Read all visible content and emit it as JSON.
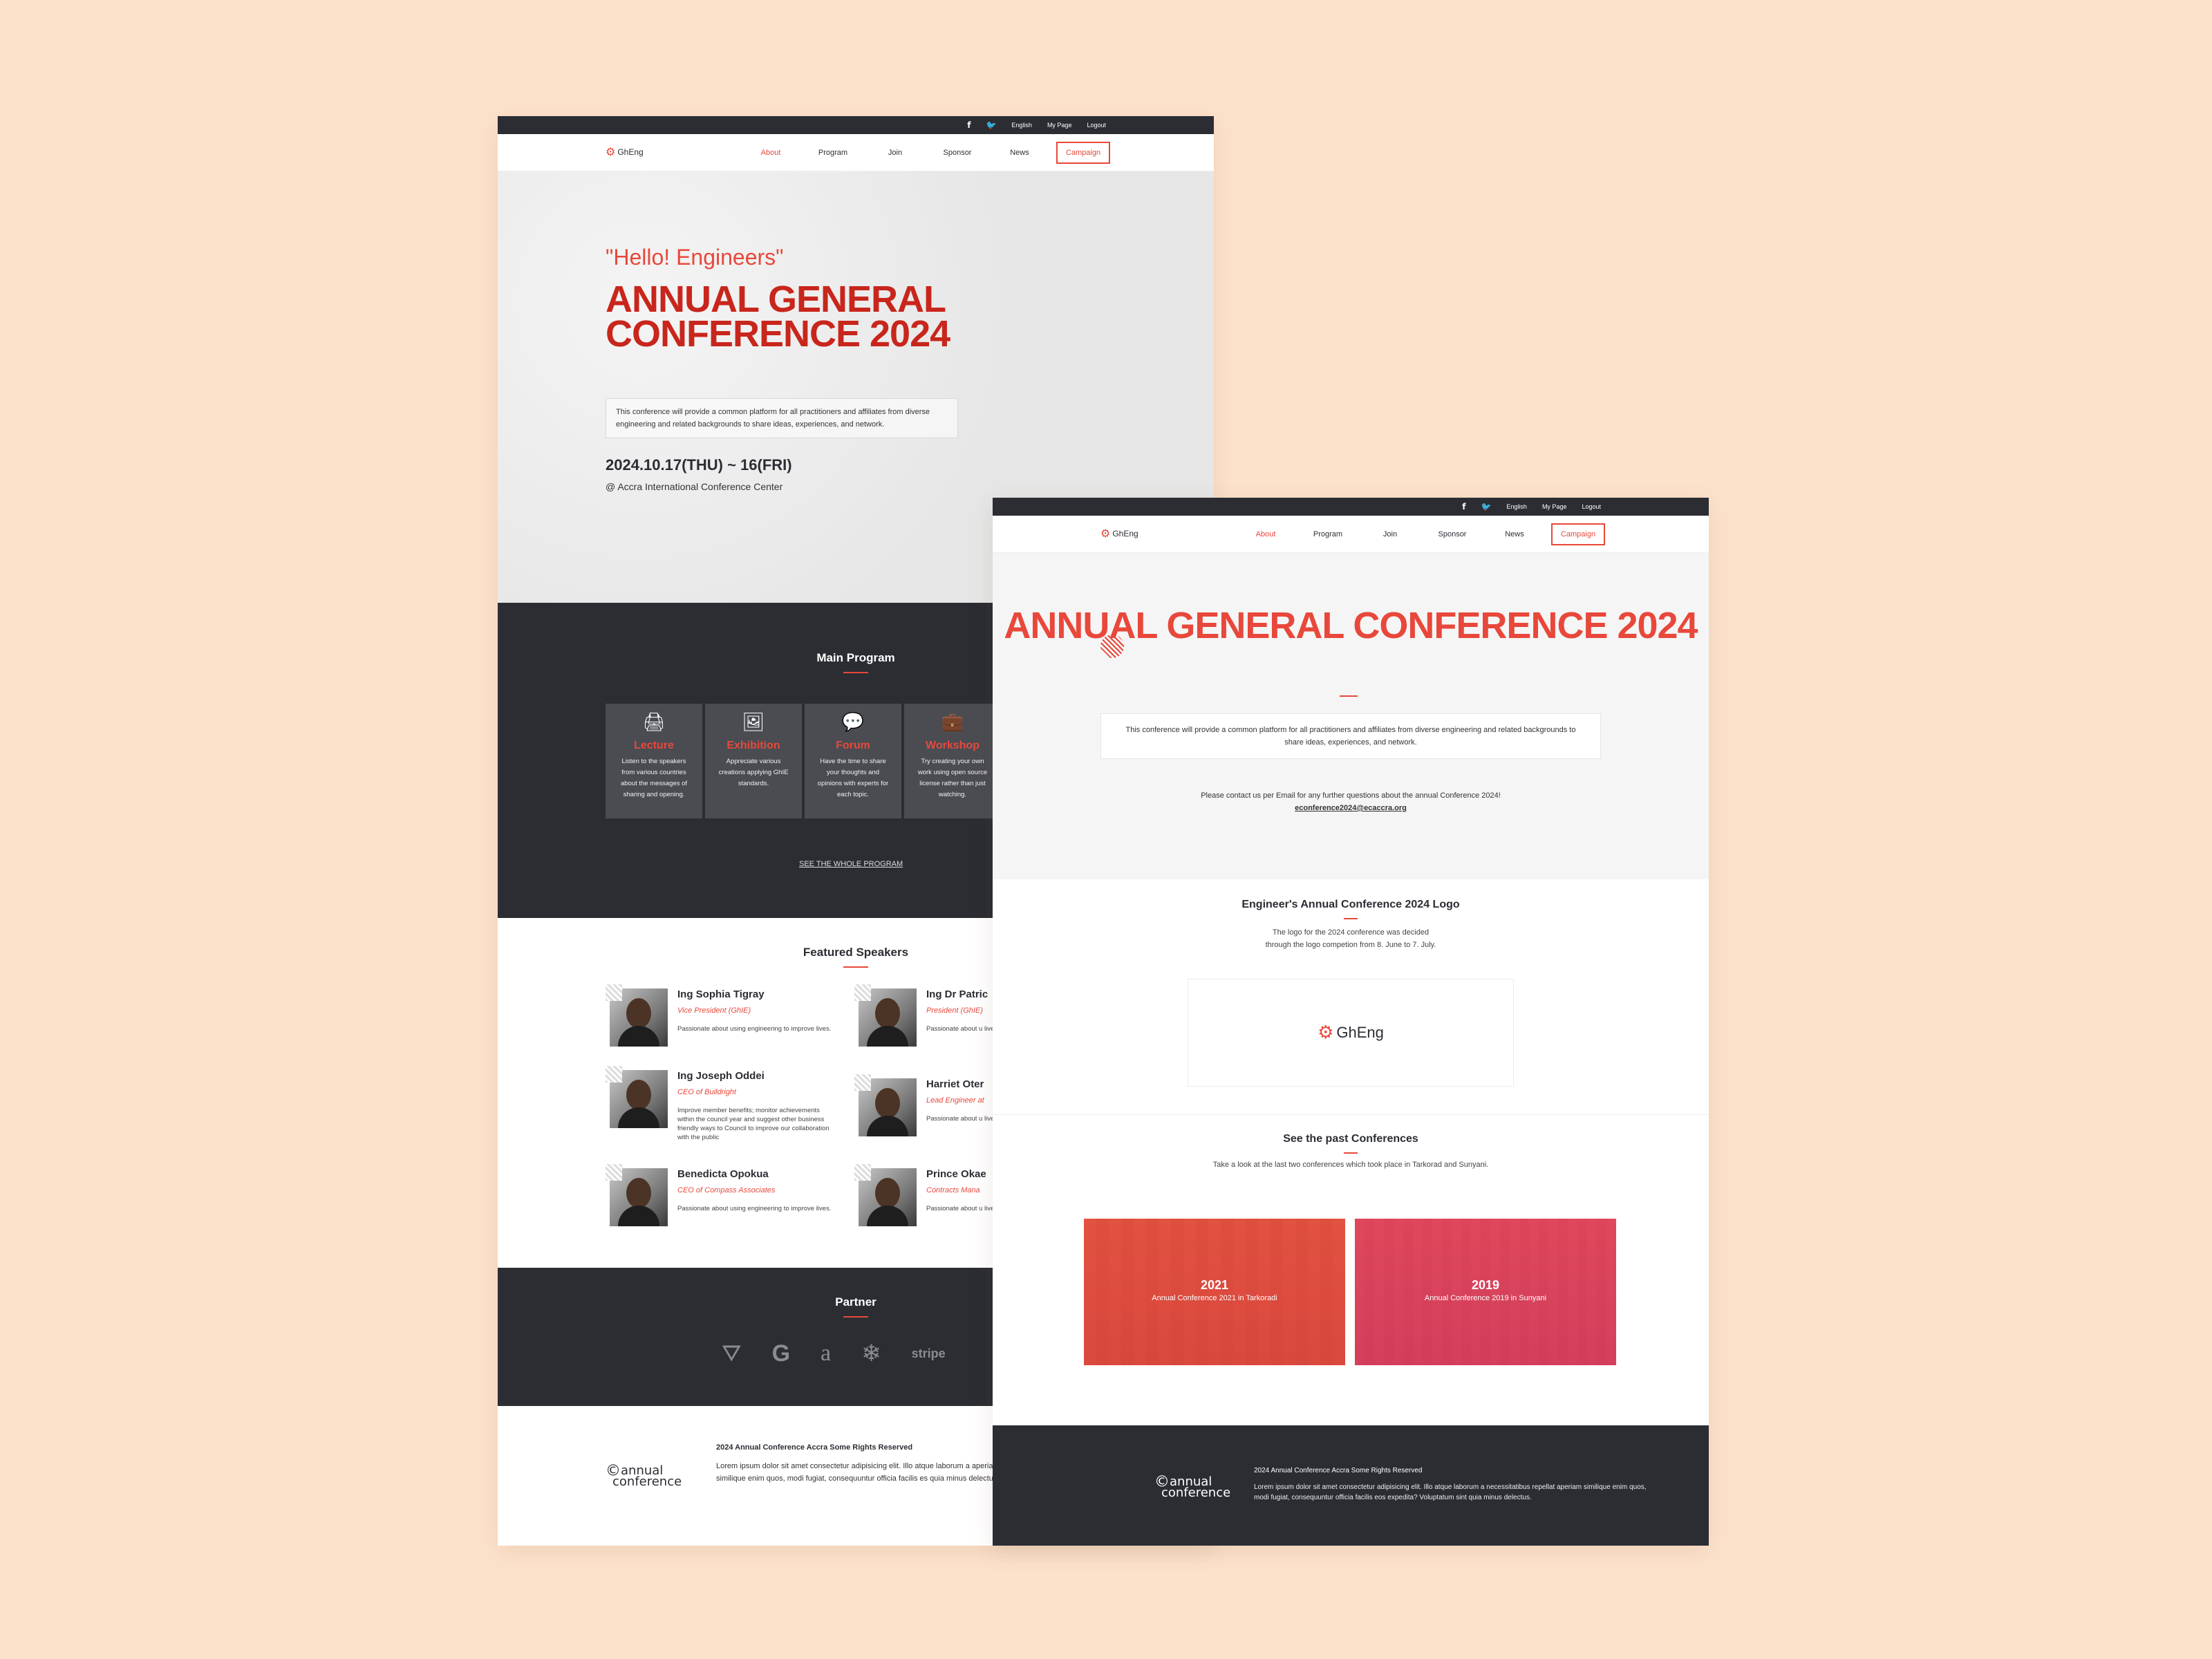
{
  "colors": {
    "background": "#fde2cb",
    "accent": "#e8483b",
    "dark": "#2b2d33"
  },
  "topbar": {
    "facebook": "f",
    "twitter": "🐦",
    "lang": "English",
    "mypage": "My Page",
    "logout": "Logout"
  },
  "nav": {
    "logo": "GhEng",
    "about": "About",
    "program": "Program",
    "join": "Join",
    "sponsor": "Sponsor",
    "news": "News",
    "campaign": "Campaign"
  },
  "pageA": {
    "hero": {
      "hello": "\"Hello! Engineers\"",
      "title": "ANNUAL GENERAL CONFERENCE 2024",
      "desc": "This conference will provide a common platform for all practitioners and affiliates from diverse engineering and related backgrounds to share ideas, experiences, and network.",
      "date": "2024.10.17(THU) ~ 16(FRI)",
      "venue": "@ Accra International Conference Center"
    },
    "program": {
      "title": "Main Program",
      "cards": [
        {
          "icon": "lecture-icon",
          "title": "Lecture",
          "desc": "Listen to the speakers from various countries about the messages of sharing and opening."
        },
        {
          "icon": "exhibition-icon",
          "title": "Exhibition",
          "desc": "Appreciate various creations applying GhIE standards."
        },
        {
          "icon": "forum-icon",
          "title": "Forum",
          "desc": "Have the time to share your thoughts and opinions with experts for each topic."
        },
        {
          "icon": "workshop-icon",
          "title": "Workshop",
          "desc": "Try creating your own work using open source license rather than just watching."
        }
      ],
      "see_all": "SEE THE WHOLE PROGRAM"
    },
    "speakers": {
      "title": "Featured Speakers",
      "list": [
        {
          "name": "Ing Sophia Tigray",
          "role": "Vice President (GhIE)",
          "desc": "Passionate about using engineering to improve lives."
        },
        {
          "name": "Ing Dr Patric",
          "role": "President (GhIE)",
          "desc": "Passionate about u lives."
        },
        {
          "name": "Ing Joseph Oddei",
          "role": "CEO of Buildright",
          "desc": "Improve member benefits; monitor achievements within the council year and suggest other business friendly ways to Council to improve our collaboration with the public"
        },
        {
          "name": "Harriet Oter",
          "role": "Lead Engineer at",
          "desc": "Passionate about u lives."
        },
        {
          "name": "Benedicta Opokua",
          "role": "CEO of Compass Associates",
          "desc": "Passionate about using engineering to improve lives."
        },
        {
          "name": "Prince Okae",
          "role": "Contracts Mana",
          "desc": "Passionate about u lives."
        }
      ]
    },
    "partner": {
      "title": "Partner",
      "logos": [
        "airbnb-icon",
        "google-icon",
        "amazon-icon",
        "snowflake-icon"
      ],
      "stripe": "stripe"
    },
    "footer": {
      "logo_top": "annual",
      "logo_bottom": "conference",
      "title": "2024 Annual Conference Accra Some Rights Reserved",
      "text": "Lorem ipsum dolor sit amet consectetur adipisicing elit. Illo atque laborum a aperiam similique enim quos, modi fugiat, consequuntur officia facilis es quia minus delectus."
    }
  },
  "pageB": {
    "hero": {
      "title": "ANNUAL GENERAL CONFERENCE 2024",
      "desc": "This conference will provide a common platform for all practitioners and affiliates from diverse engineering and related backgrounds to share ideas, experiences, and network.",
      "contact": "Please contact us per Email for any further questions about the annual Conference 2024!",
      "email": "econference2024@ecaccra.org"
    },
    "logo_section": {
      "title": "Engineer's Annual Conference 2024 Logo",
      "desc1": "The logo for the 2024 conference was decided",
      "desc2": "through the logo competion from 8. June to 7. July.",
      "logo": "GhEng"
    },
    "past": {
      "title": "See the past Conferences",
      "desc": "Take a look at the last two conferences which took place in Tarkorad and Sunyani.",
      "items": [
        {
          "year": "2021",
          "label": "Annual Conference 2021 in Tarkoradi"
        },
        {
          "year": "2019",
          "label": "Annual Conference 2019 in Sunyani"
        }
      ]
    },
    "footer": {
      "logo_top": "annual",
      "logo_bottom": "conference",
      "title": "2024 Annual Conference Accra Some Rights Reserved",
      "text": "Lorem ipsum dolor sit amet consectetur adipisicing elit. Illo atque laborum a necessitatibus repellat aperiam similique enim quos, modi fugiat, consequuntur officia facilis eos expedita? Voluptatum sint quia minus delectus."
    }
  }
}
